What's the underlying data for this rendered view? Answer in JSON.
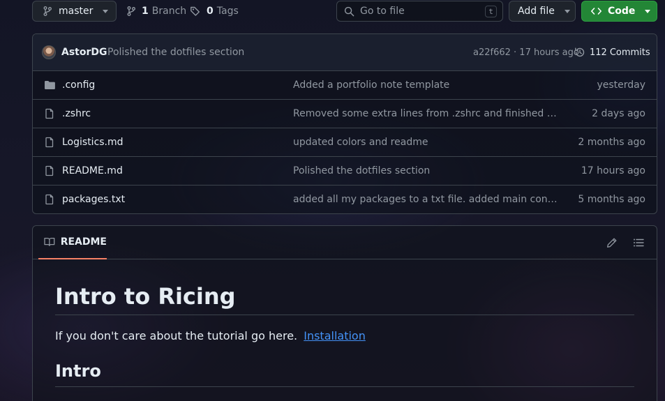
{
  "toolbar": {
    "branch_name": "master",
    "branch_count": "1",
    "branch_label": "Branch",
    "tag_count": "0",
    "tag_label": "Tags",
    "goto_placeholder": "Go to file",
    "goto_shortcut": "t",
    "add_file_label": "Add file",
    "code_label": "Code",
    "code_color": "#238636"
  },
  "commit": {
    "author": "AstorDG",
    "message": "Polished the dotfiles section",
    "hash_time": "a22f662 · 17 hours ago",
    "commits_count": "112",
    "commits_label": "Commits"
  },
  "files": [
    {
      "name": ".config",
      "type": "folder",
      "message": "Added a portfolio note template",
      "date": "yesterday"
    },
    {
      "name": ".zshrc",
      "type": "file",
      "message": "Removed some extra lines from .zshrc and finished som…",
      "date": "2 days ago"
    },
    {
      "name": "Logistics.md",
      "type": "file",
      "message": "updated colors and readme",
      "date": "2 months ago"
    },
    {
      "name": "README.md",
      "type": "file",
      "message": "Polished the dotfiles section",
      "date": "17 hours ago"
    },
    {
      "name": "packages.txt",
      "type": "file",
      "message": "added all my packages to a txt file. added main config pa…",
      "date": "5 months ago"
    }
  ],
  "readme": {
    "tab_label": "README",
    "tab_underline_color": "#f78166",
    "heading": "Intro to Ricing",
    "paragraph": "If you don't care about the tutorial go here.",
    "link_text": "Installation",
    "link_color": "#4493f8",
    "subheading": "Intro"
  }
}
